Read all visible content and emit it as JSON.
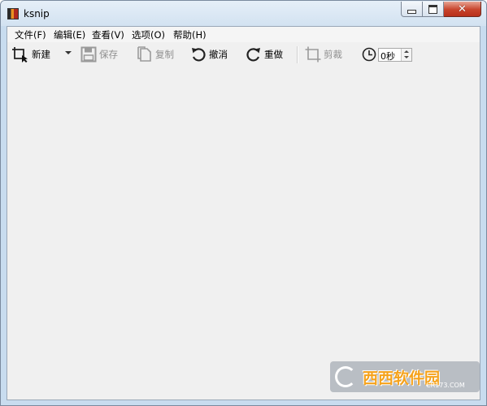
{
  "window": {
    "title": "ksnip",
    "close_glyph": "✕"
  },
  "menu": [
    {
      "label": "文件(F)"
    },
    {
      "label": "编辑(E)"
    },
    {
      "label": "查看(V)"
    },
    {
      "label": "选项(O)"
    },
    {
      "label": "帮助(H)"
    }
  ],
  "toolbar": {
    "new_label": "新建",
    "save_label": "保存",
    "copy_label": "复制",
    "undo_label": "撤消",
    "redo_label": "重做",
    "crop_label": "剪裁",
    "delay_value": "0秒"
  },
  "watermark": {
    "text": "西西软件园",
    "subtext": "CR173.COM"
  },
  "icons": [
    "app-icon",
    "new-capture-icon",
    "save-icon",
    "copy-icon",
    "undo-icon",
    "redo-icon",
    "crop-icon",
    "clock-icon"
  ]
}
